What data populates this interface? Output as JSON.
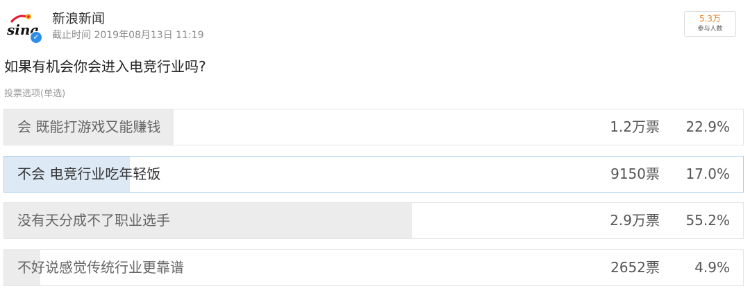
{
  "account": {
    "name": "新浪新闻",
    "avatar_icon": "sina-logo-icon",
    "avatar_text": "sina",
    "verified_icon": "verified-badge-icon",
    "deadline": "截止时间 2019年08月13日 11:19"
  },
  "participants": {
    "count": "5.3万",
    "label": "参与人数"
  },
  "poll": {
    "question": "如果有机会你会进入电竞行业吗?",
    "vote_type": "投票选项(单选)",
    "options": [
      {
        "label": "会 既能打游戏又能赚钱",
        "count": "1.2万票",
        "percent": "22.9%",
        "share": 0.229,
        "selected": false
      },
      {
        "label": "不会 电竞行业吃年轻饭",
        "count": "9150票",
        "percent": "17.0%",
        "share": 0.17,
        "selected": true
      },
      {
        "label": "没有天分成不了职业选手",
        "count": "2.9万票",
        "percent": "55.2%",
        "share": 0.552,
        "selected": false
      },
      {
        "label": "不好说感觉传统行业更靠谱",
        "count": "2652票",
        "percent": "4.9%",
        "share": 0.049,
        "selected": false
      }
    ]
  },
  "colors": {
    "accent_orange": "#e8821e",
    "selected_border": "#a6cdef",
    "selected_fill": "#dde9f4",
    "bar_fill": "#ececec",
    "verified_blue": "#2f8fe6",
    "sina_red": "#e6162d"
  }
}
